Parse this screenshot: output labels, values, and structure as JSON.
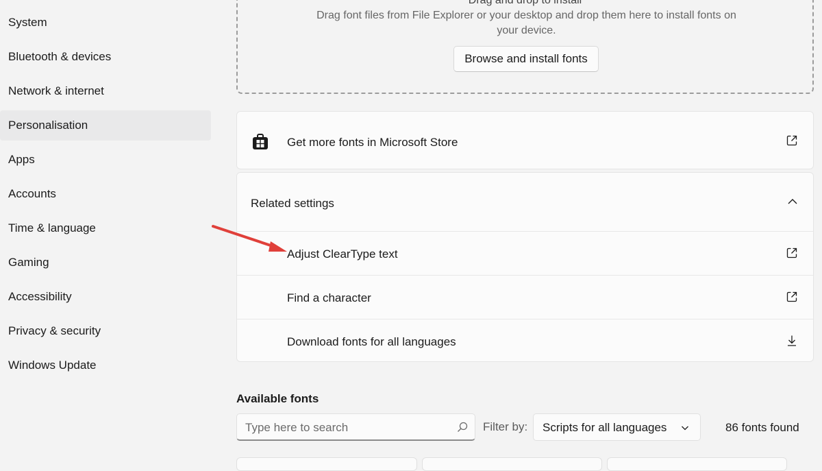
{
  "sidebar": {
    "items": [
      {
        "label": "System"
      },
      {
        "label": "Bluetooth & devices"
      },
      {
        "label": "Network & internet"
      },
      {
        "label": "Personalisation",
        "selected": true
      },
      {
        "label": "Apps"
      },
      {
        "label": "Accounts"
      },
      {
        "label": "Time & language"
      },
      {
        "label": "Gaming"
      },
      {
        "label": "Accessibility"
      },
      {
        "label": "Privacy & security"
      },
      {
        "label": "Windows Update"
      }
    ]
  },
  "dropzone": {
    "title": "Drag and drop to install",
    "description": "Drag font files from File Explorer or your desktop and drop them here to install fonts on your device.",
    "browse_label": "Browse and install fonts"
  },
  "store": {
    "label": "Get more fonts in Microsoft Store",
    "icon": "store-icon"
  },
  "related": {
    "title": "Related settings",
    "items": [
      {
        "label": "Adjust ClearType text",
        "icon": "external-link-icon"
      },
      {
        "label": "Find a character",
        "icon": "external-link-icon"
      },
      {
        "label": "Download fonts for all languages",
        "icon": "download-icon"
      }
    ]
  },
  "available": {
    "title": "Available fonts",
    "search_placeholder": "Type here to search",
    "filter_label": "Filter by:",
    "filter_value": "Scripts for all languages",
    "count": "86 fonts found"
  },
  "colors": {
    "background": "#f3f3f3",
    "card": "#fbfbfb",
    "selected": "#e9e9ea",
    "annotation_arrow": "#e0403a"
  }
}
